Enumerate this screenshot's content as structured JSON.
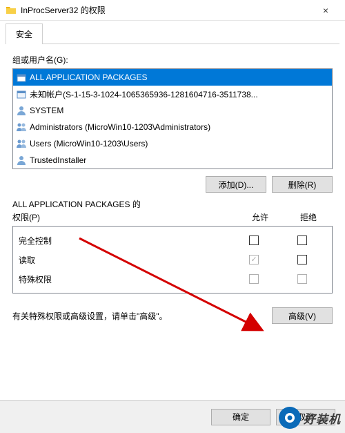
{
  "window": {
    "title": "InProcServer32 的权限",
    "close": "×"
  },
  "tabs": {
    "security": "安全"
  },
  "groups": {
    "label": "组或用户名(G):",
    "items": [
      {
        "label": "ALL APPLICATION PACKAGES",
        "icon": "package"
      },
      {
        "label": "未知帐户(S-1-15-3-1024-1065365936-1281604716-3511738...",
        "icon": "package"
      },
      {
        "label": "SYSTEM",
        "icon": "user"
      },
      {
        "label": "Administrators (MicroWin10-1203\\Administrators)",
        "icon": "group"
      },
      {
        "label": "Users (MicroWin10-1203\\Users)",
        "icon": "group"
      },
      {
        "label": "TrustedInstaller",
        "icon": "user"
      }
    ]
  },
  "buttons": {
    "add": "添加(D)...",
    "remove": "删除(R)",
    "advanced": "高级(V)",
    "ok": "确定",
    "cancel": "取消"
  },
  "permissions": {
    "header_prefix": "ALL APPLICATION PACKAGES 的",
    "header_label": "权限(P)",
    "col_allow": "允许",
    "col_deny": "拒绝",
    "rows": [
      {
        "label": "完全控制",
        "allow": false,
        "deny": false,
        "disabled": false
      },
      {
        "label": "读取",
        "allow": true,
        "deny": false,
        "disabled": true
      },
      {
        "label": "特殊权限",
        "allow": false,
        "deny": false,
        "disabled": true
      }
    ]
  },
  "advanced_hint": "有关特殊权限或高级设置，请单击\"高级\"。",
  "watermark": "好装机"
}
